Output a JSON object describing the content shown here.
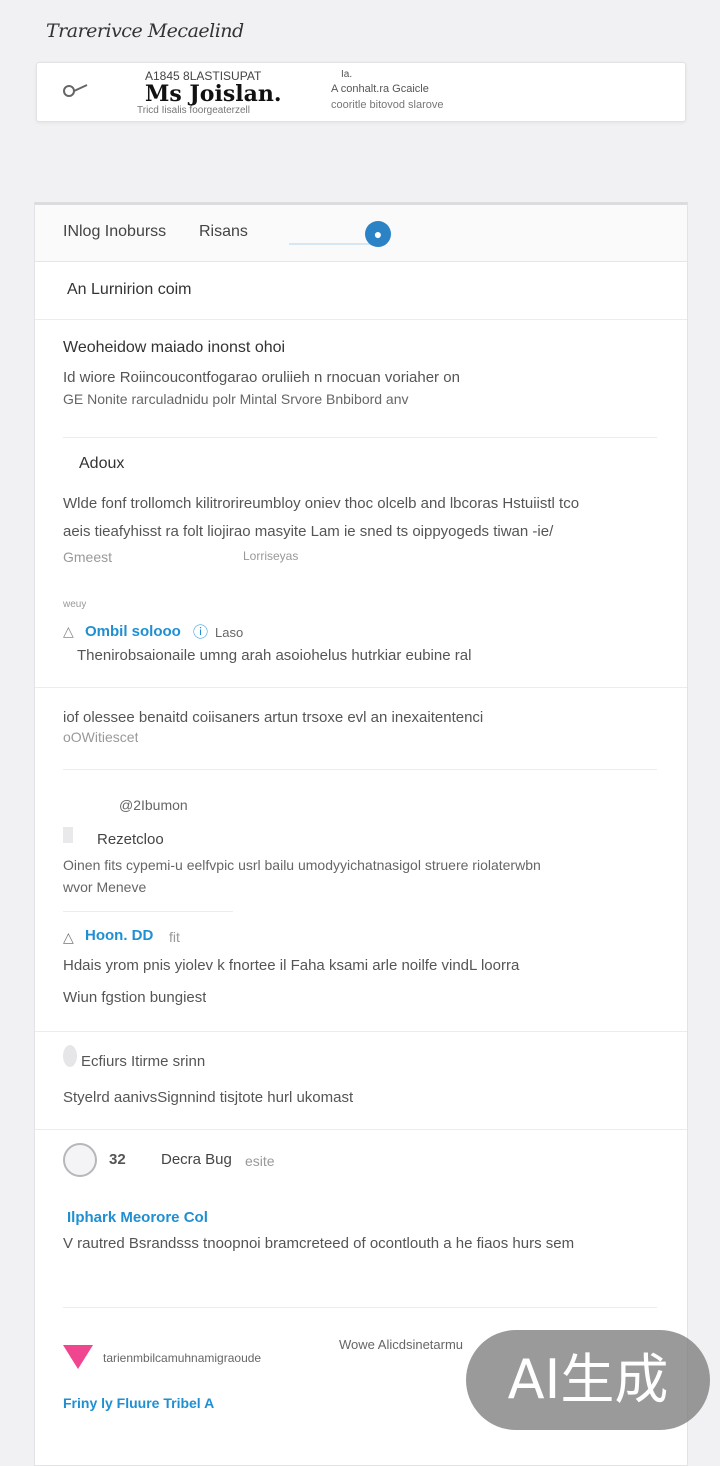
{
  "page_title": "Trarerivce Mecaelind",
  "header_card": {
    "kicker": "A1845  8LASTISUPAT",
    "name": "Ms Joislan.",
    "sub": "Tricd Iisalis foorgeaterzell",
    "mini": "Ia.",
    "line1": "A conhalt.ra   Gcaicle",
    "line2": "cooritle bitovod slarove"
  },
  "tabs": [
    "INlog Inoburss",
    "Risans"
  ],
  "tab_icon": "globe-icon",
  "sections": {
    "intro": "An Lurnirion coim",
    "block1_title": "Weoheidow maiado inonst ohoi",
    "block1_line1": "Id wiore Roiincoucontfogarao oruliieh n rnocuan voriaher on",
    "block1_line2": "GE Nonite rarculadnidu polr Mintal Srvore Bnbibord anv",
    "about_heading": "Adoux",
    "about_line1": "Wlde fonf trollomch kilitrorireumbloy oniev thoc olcelb and lbcoras  Hstuiistl tco",
    "about_line2": "aeis tieafyhisst ra folt liojirao masyite  Lam  ie  sned ts oippyogeds tiwan  -ie/",
    "about_line3": "Gmeest",
    "about_line3b": "Lorriseyas",
    "small_label": "weuy",
    "link1": "Ombil solooo",
    "link1_meta": "Laso",
    "desc1": "Thenirobsaionaile umng arah asoiohelus hutrkiar eubine ral",
    "block2_line1": "iof olessee benaitd coiisaners artun trsoxe evl an inexaitentenci",
    "block2_line2": "oOWitiescet",
    "meta_label": "@2Ibumon",
    "sub_heading": "Rezetcloo",
    "block3_line1": "Oinen fits cypemi-u eelfvpic  usrl bailu umodyyichatnasigol struere riolaterwbn",
    "block3_line2": "wvor Meneve",
    "link2": "Hoon. DD",
    "link2_meta": "fit",
    "block4_line1": "Hdais yrom pnis yiolev k fnortee il Faha ksami arle noilfe vindL loorra",
    "block4_line2": "Wiun fgstion bungiest",
    "features_heading": "Ecfiurs Itirme srinn",
    "features_line": "Styelrd aanivsSignnind tisjtote hurl ukomast",
    "author_num": "32",
    "author_name": "Decra Bug",
    "author_tag": "esite",
    "link3": "Ilphark Meorore Col",
    "desc3": "V rautred Bsrandsss tnoopnoi bramcreteed of ocontlouth a he fiaos hurs sem",
    "footer_item": "tarienmbilcamuhnamigraoude",
    "footer_right": "Wowe Alicdsinetarmu",
    "footer_link": "Friny ly Fluure Tribel A"
  },
  "badge": "AI生成",
  "colors": {
    "accent": "#1f8fd2",
    "globe": "#2b83c6",
    "pink": "#f0458f",
    "background": "#f1f1f3"
  }
}
